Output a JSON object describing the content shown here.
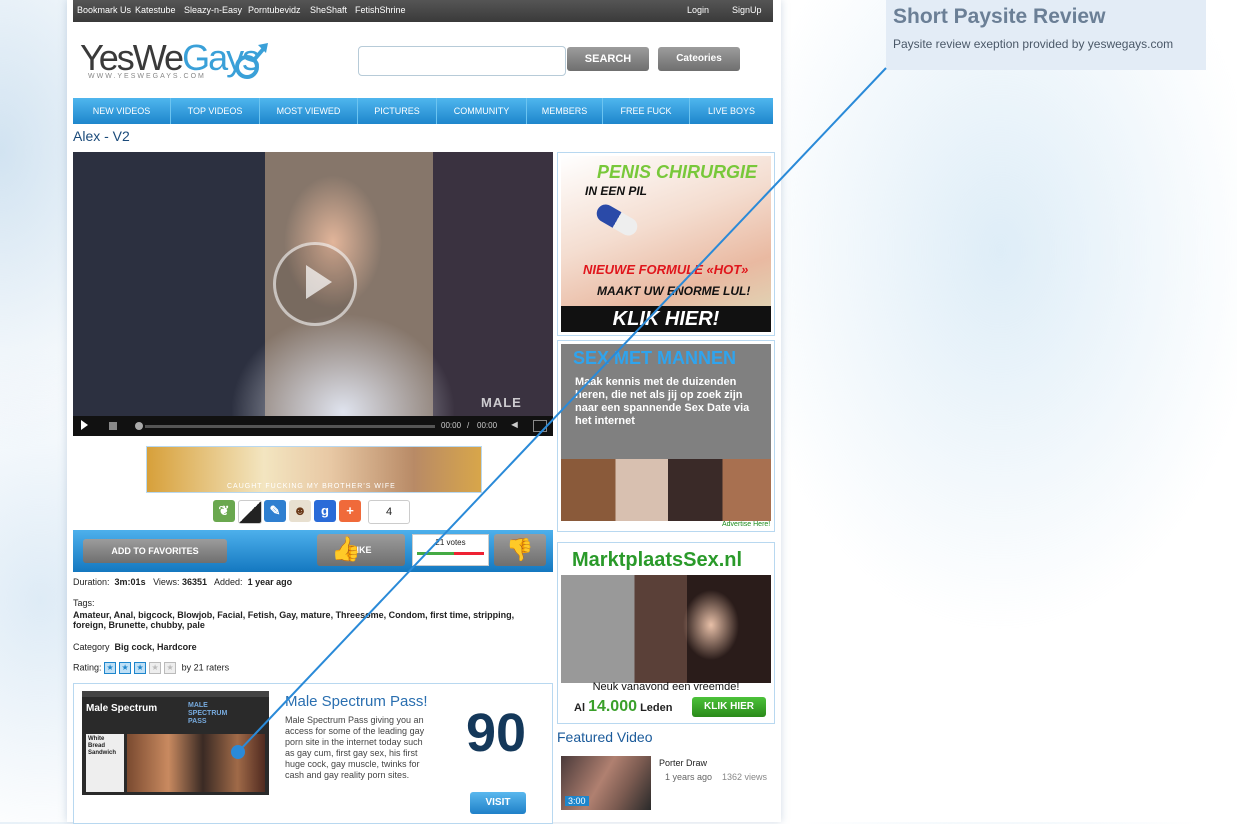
{
  "topbar": {
    "links": [
      "Bookmark Us",
      "Katestube",
      "Sleazy-n-Easy",
      "Porntubevidz",
      "SheShaft",
      "FetishShrine"
    ],
    "login": "Login",
    "signup": "SignUp"
  },
  "logo": {
    "text_a": "YesWe",
    "text_b": "Gays",
    "url": "WWW.YESWEGAYS.COM"
  },
  "search": {
    "button": "SEARCH",
    "categories": "Cateories"
  },
  "nav": [
    "NEW VIDEOS",
    "TOP VIDEOS",
    "MOST VIEWED",
    "PICTURES",
    "COMMUNITY",
    "MEMBERS",
    "FREE FUCK",
    "LIVE BOYS"
  ],
  "video": {
    "title": "Alex - V2",
    "watermark": "MALE",
    "time_current": "00:00",
    "time_sep": "/",
    "time_total": "00:00"
  },
  "banner": {
    "caption": "CAUGHT FUCKING MY BROTHER'S WIFE"
  },
  "share": {
    "count": "4"
  },
  "actions": {
    "favorites": "ADD TO FAVORITES",
    "like": "LIKE",
    "votes": "21 votes"
  },
  "details": {
    "duration_label": "Duration:",
    "duration": "3m:01s",
    "views_label": "Views:",
    "views": "36351",
    "added_label": "Added:",
    "added": "1 year ago",
    "tags_label": "Tags:",
    "tags_line1": "Amateur, Anal, bigcock, Blowjob, Facial, Fetish, Gay, mature, Threesome, Condom, first time, stripping,",
    "tags_line2": "foreign, Brunette, chubby, pale",
    "category_label": "Category",
    "category": "Big cock, Hardcore",
    "rating_label": "Rating:",
    "rating_text": "by 21 raters",
    "rating_stars": 3
  },
  "review": {
    "title": "Male Spectrum Pass!",
    "text": "Male Spectrum Pass giving you an access for some of the leading gay porn site in the internet today such as gay cum, first gay sex, his first huge cock, gay muscle, twinks for cash and gay reality porn sites.",
    "score": "90",
    "visit": "VISIT",
    "thumb_logo": "Male Spectrum",
    "thumb_badge": "MALE SPECTRUM PASS",
    "thumb_title": "White Bread Sandwich"
  },
  "ads": {
    "ad1": {
      "line1": "PENIS CHIRURGIE",
      "line2": "IN EEN PIL",
      "line3": "NIEUWE FORMULE «HOT»",
      "line4": "MAAKT UW ENORME LUL!",
      "cta": "KLIK HIER!"
    },
    "ad2": {
      "title": "SEX MET MANNEN",
      "text": "Maak kennis met de duizenden heren, die net als jij op zoek zijn naar een spannende Sex Date via het internet",
      "advertise": "Advertise Here!"
    },
    "ad3": {
      "brand": "MarktplaatsSex.nl",
      "tagline": "Neuk vanavond een vreemde!",
      "prefix": "Al",
      "count": "14.000",
      "suffix": "Leden",
      "cta": "KLIK HIER"
    }
  },
  "featured": {
    "heading": "Featured Video",
    "title": "Porter Draw",
    "age": "1 years ago",
    "views": "1362 views",
    "duration": "3:00"
  },
  "overlay": {
    "title": "Short Paysite Review",
    "subtitle": "Paysite review exeption provided by yeswegays.com"
  }
}
